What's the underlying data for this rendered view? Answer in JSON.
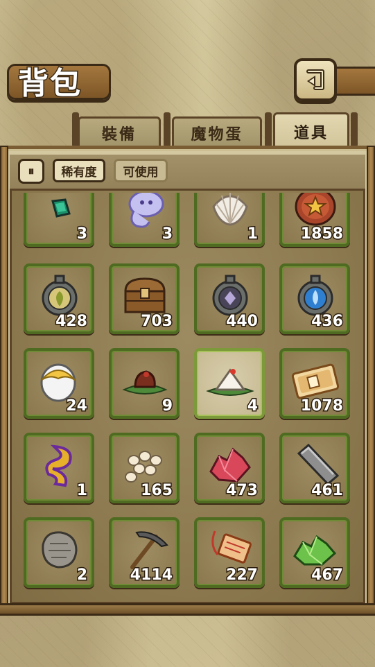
{
  "header": {
    "title": "背包",
    "back_icon": "return-arrow-icon"
  },
  "tabs": [
    {
      "label": "裝備",
      "active": false
    },
    {
      "label": "魔物蛋",
      "active": false
    },
    {
      "label": "道具",
      "active": true
    }
  ],
  "filters": {
    "pause_label": "⏸",
    "rarity_label": "稀有度",
    "usable_label": "可使用",
    "active_filter": "稀有度"
  },
  "items": [
    {
      "icon": "green-gem-icon",
      "count": "3"
    },
    {
      "icon": "purple-ghost-icon",
      "count": "3"
    },
    {
      "icon": "seashell-icon",
      "count": "1"
    },
    {
      "icon": "star-coin-icon",
      "count": "1858"
    },
    {
      "icon": "leaf-emblem-icon",
      "count": "428"
    },
    {
      "icon": "treasure-chest-icon",
      "count": "703"
    },
    {
      "icon": "dark-emblem-icon",
      "count": "440"
    },
    {
      "icon": "water-emblem-icon",
      "count": "436"
    },
    {
      "icon": "golden-egg-icon",
      "count": "24"
    },
    {
      "icon": "chocolate-cake-icon",
      "count": "9"
    },
    {
      "icon": "rice-dumpling-icon",
      "count": "4",
      "selected": true
    },
    {
      "icon": "ticket-icon",
      "count": "1078"
    },
    {
      "icon": "golden-dragon-icon",
      "count": "1"
    },
    {
      "icon": "white-stones-icon",
      "count": "165"
    },
    {
      "icon": "red-crystal-icon",
      "count": "473"
    },
    {
      "icon": "iron-ingot-icon",
      "count": "461"
    },
    {
      "icon": "stone-tablet-icon",
      "count": "2"
    },
    {
      "icon": "pickaxe-icon",
      "count": "4114"
    },
    {
      "icon": "red-charm-icon",
      "count": "227"
    },
    {
      "icon": "green-crystal-icon",
      "count": "467"
    }
  ]
}
